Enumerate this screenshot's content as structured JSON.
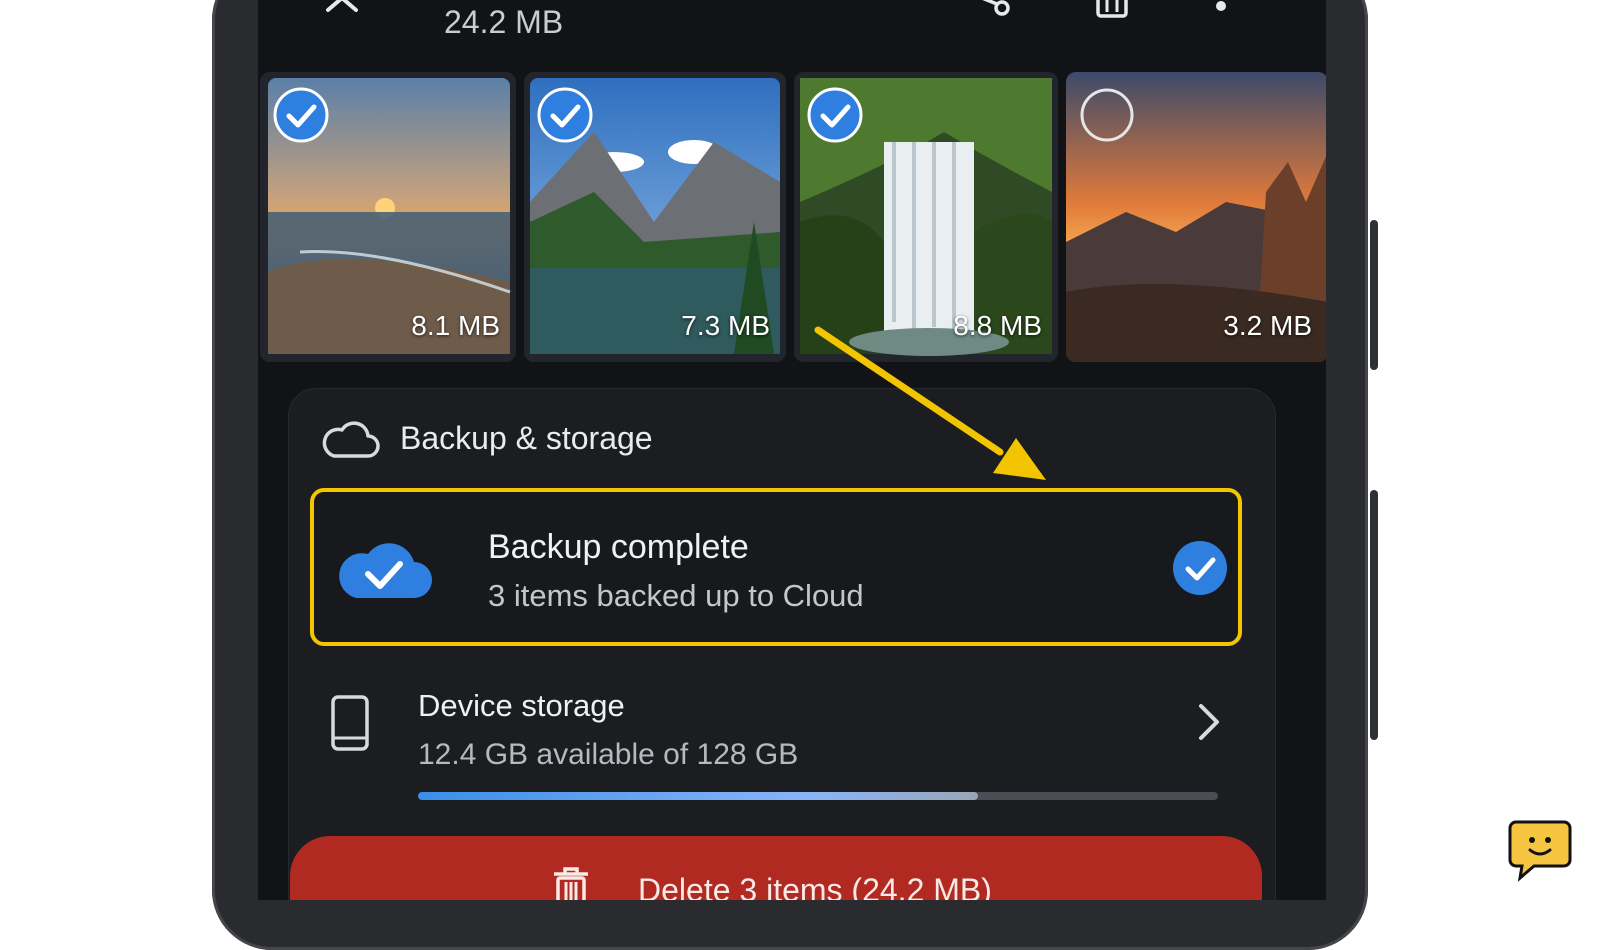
{
  "appbar": {
    "total_size": "24.2 MB",
    "icons": [
      "close-icon",
      "share-icon",
      "trash-icon",
      "more-vert-icon"
    ]
  },
  "thumbnails": [
    {
      "subject": "beach-sunset",
      "size": "8.1 MB",
      "selected": true
    },
    {
      "subject": "mountain-lake",
      "size": "7.3 MB",
      "selected": true
    },
    {
      "subject": "waterfall",
      "size": "8.8 MB",
      "selected": true
    },
    {
      "subject": "canyon-sunset",
      "size": "3.2 MB",
      "selected": false
    }
  ],
  "backup_storage": {
    "title": "Backup & storage",
    "backup": {
      "title": "Backup complete",
      "subtitle": "3 items backed up to Cloud"
    },
    "device": {
      "title": "Device storage",
      "subtitle": "12.4 GB available of 128 GB",
      "used_fraction": 0.7
    }
  },
  "delete_button": {
    "label": "Delete 3 items (24.2 MB)"
  },
  "colors": {
    "accent_blue": "#2f7fe0",
    "highlight_yellow": "#f2c500",
    "delete_red": "#b12a21",
    "screen_bg": "#121316"
  }
}
